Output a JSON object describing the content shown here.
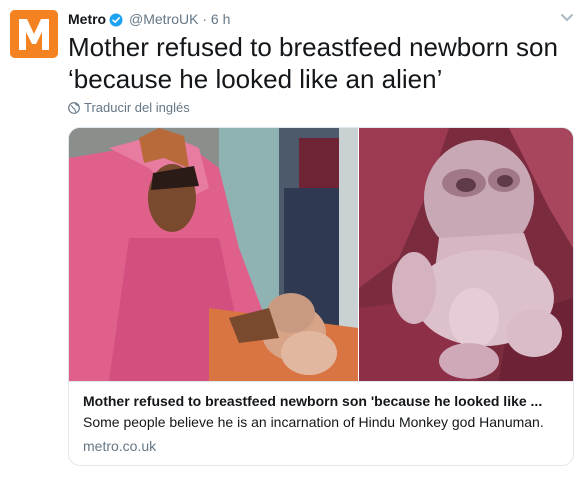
{
  "tweet": {
    "author_name": "Metro",
    "handle": "@MetroUK",
    "separator": "·",
    "time": "6 h",
    "text": "Mother refused to breastfeed newborn son ‘because he looked like an alien’",
    "translate_label": "Traducir del inglés",
    "avatar_letter": "M",
    "colors": {
      "brand": "#f58220",
      "verified": "#1da1f2",
      "secondary_text": "#657786"
    }
  },
  "card": {
    "title": "Mother refused to breastfeed newborn son 'because he looked like ...",
    "description": "Some people believe he is an incarnation of Hindu Monkey god Hanuman.",
    "domain": "metro.co.uk"
  },
  "icons": {
    "verified": "verified-badge-icon",
    "menu": "chevron-down-icon",
    "translate": "globe-icon"
  }
}
